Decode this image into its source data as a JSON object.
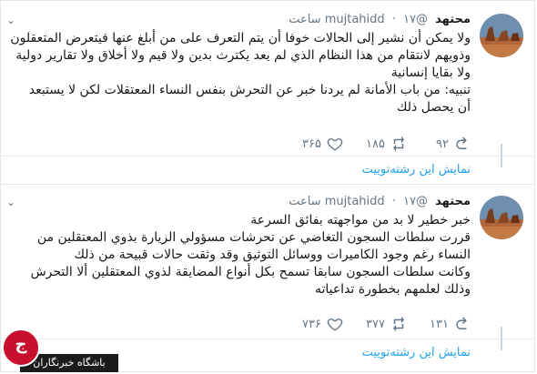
{
  "tweets": [
    {
      "name": "محتهد",
      "handle": "@mujtahidd",
      "time": "۱۷ ساعت",
      "text": "ولا يمكن أن نشير إلى الحالات خوفا أن يتم التعرف على من أبلغ عنها فيتعرض المتعقلون\nوذويهم لانتقام من هذا النظام الذي لم يعد يكترث بدين ولا قيم ولا أخلاق ولا تقارير دولية\nولا بقايا إنسانية\nتنبيه: من باب الأمانة لم يردنا خبر عن التحرش بنفس النساء المعتقلات لكن لا يستبعد\nأن يحصل ذلك",
      "replies": "۹۲",
      "retweets": "۱۸۵",
      "likes": "۳۶۵",
      "thread_link": "نمايش اين رشته‌توييت"
    },
    {
      "name": "محتهد",
      "handle": "@mujtahidd",
      "time": "۱۷ ساعت",
      "text": "خبر خطير لا بد من مواجهته بفائق السرعة\nقررت سلطات السجون التغاضي عن تحرشات مسؤولي الزيارة بذوي المعتقلين من\nالنساء رغم وجود الكاميرات ووسائل التوثيق وقد وثقت حالات قبيحة من ذلك\nوكانت سلطات السجون سابقا تسمح بكل أنواع المضايقة لذوي المعتقلين ألا التحرش\nوذلك لعلمهم بخطورة تداعياته",
      "replies": "۱۳۱",
      "retweets": "۳۷۷",
      "likes": "۷۳۶",
      "thread_link": "نمايش اين رشته‌توييت"
    }
  ],
  "watermark": {
    "text": "باشگاه خبرنگاران",
    "glyph": "ج"
  },
  "icons": {
    "reply": "reply-icon",
    "retweet": "retweet-icon",
    "like": "heart-icon",
    "caret": "chevron-down-icon"
  },
  "colors": {
    "link": "#1da1f2",
    "muted": "#657786",
    "watermark_red": "#c8102e"
  }
}
